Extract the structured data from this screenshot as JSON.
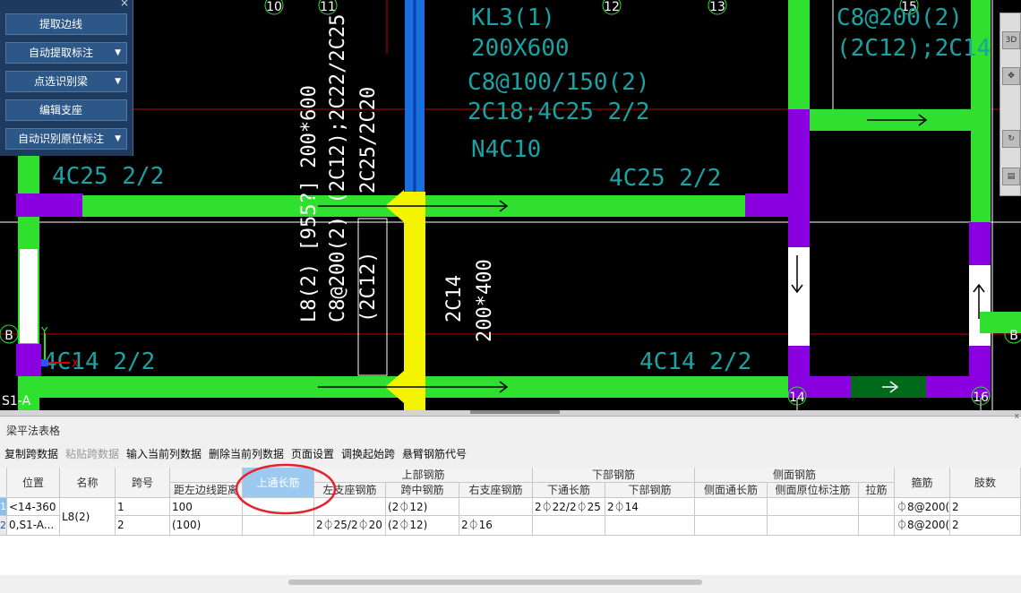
{
  "panel": {
    "buttons": [
      {
        "label": "提取边线",
        "dropdown": false
      },
      {
        "label": "自动提取标注",
        "dropdown": true
      },
      {
        "label": "点选识别梁",
        "dropdown": true
      },
      {
        "label": "编辑支座",
        "dropdown": false
      },
      {
        "label": "自动识别原位标注",
        "dropdown": true
      }
    ],
    "close_glyph": "×"
  },
  "drawing": {
    "axis_labels": {
      "a10": "10",
      "a11": "11",
      "a12": "12",
      "a13": "13",
      "a15": "15",
      "a14": "14",
      "a16": "16",
      "b_left": "B",
      "b_right": "B"
    },
    "s1_label": "S1-A",
    "kl3": {
      "name": "KL3(1)",
      "size": "200X600",
      "stirrup": "C8@100/150(2)",
      "rebar": "2C18;4C25 2/2",
      "waist": "N4C10"
    },
    "top_right": {
      "line1": "C8@200(2)",
      "line2": "(2C12);2C14"
    },
    "beam_top_left": "4C25 2/2",
    "beam_top_right": "4C25 2/2",
    "beam_bottom_left": "4C14 2/2",
    "beam_bottom_right": "4C14 2/2",
    "l8": {
      "line1": "L8(2) [955?] 200*600",
      "line2": "C8@200(2) (2C12);2C22/2C25",
      "line3": "(2C12)",
      "line4": "2C25/2C20"
    },
    "mid_beam": {
      "line1": "2C14",
      "line2": "200*400"
    },
    "ucs": {
      "y": "Y",
      "x": "X"
    },
    "colors": {
      "beam_green": "#2fe02f",
      "support_purple": "#8a00e0",
      "selected_yellow": "#f4f400",
      "column_blue": "#1a6fe0",
      "axis_red": "#c00000",
      "grid_white": "#ffffff",
      "text_cyan": "#1aa3a3"
    }
  },
  "right_toolbar": {
    "icons": [
      "view-cube-icon",
      "pan-icon",
      "orbit-icon",
      "layers-icon"
    ],
    "top_label": "3D"
  },
  "table": {
    "title": "梁平法表格",
    "close_glyph": "x",
    "toolbar": [
      {
        "label": "复制跨数据",
        "disabled": false
      },
      {
        "label": "粘贴跨数据",
        "disabled": true
      },
      {
        "label": "输入当前列数据",
        "disabled": false
      },
      {
        "label": "删除当前列数据",
        "disabled": false
      },
      {
        "label": "页面设置",
        "disabled": false
      },
      {
        "label": "调换起始跨",
        "disabled": false
      },
      {
        "label": "悬臂钢筋代号",
        "disabled": false
      }
    ],
    "group_headers": {
      "top_rebar": "上部钢筋",
      "bottom_rebar": "下部钢筋",
      "side_rebar": "侧面钢筋"
    },
    "columns": {
      "position": "位置",
      "name": "名称",
      "span": "跨号",
      "dist": "距左边线距离",
      "top_through": "上通长筋",
      "left_seat": "左支座钢筋",
      "mid_span": "跨中钢筋",
      "right_seat": "右支座钢筋",
      "bottom_through": "下通长筋",
      "bottom_rebar": "下部钢筋",
      "side_through": "侧面通长筋",
      "side_in_situ": "侧面原位标注筋",
      "tie": "拉筋",
      "stirrup": "箍筋",
      "legs": "肢数"
    },
    "rows": [
      {
        "row_no": "1",
        "position": "<14-360",
        "name": "L8(2)",
        "span": "1",
        "dist": "100",
        "top_through": "",
        "left_seat": "",
        "mid_span": "(2⏀12)",
        "right_seat": "",
        "bottom_through": "2⏀22/2⏀25",
        "bottom_rebar": "2⏀14",
        "side_through": "",
        "side_in_situ": "",
        "tie": "",
        "stirrup": "⏀8@200(",
        "legs": "2"
      },
      {
        "row_no": "2",
        "position": "0,S1-A...",
        "name": "",
        "span": "2",
        "dist": "(100)",
        "top_through": "",
        "left_seat": "2⏀25/2⏀20",
        "mid_span": "(2⏀12)",
        "right_seat": "2⏀16",
        "bottom_through": "",
        "bottom_rebar": "",
        "side_through": "",
        "side_in_situ": "",
        "tie": "",
        "stirrup": "⏀8@200(",
        "legs": "2"
      }
    ]
  }
}
